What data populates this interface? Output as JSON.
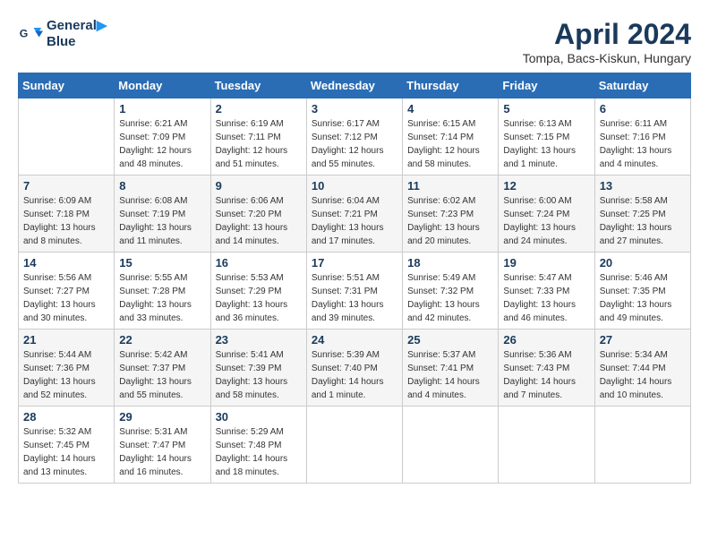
{
  "header": {
    "logo_line1": "General",
    "logo_line2": "Blue",
    "month_title": "April 2024",
    "location": "Tompa, Bacs-Kiskun, Hungary"
  },
  "weekdays": [
    "Sunday",
    "Monday",
    "Tuesday",
    "Wednesday",
    "Thursday",
    "Friday",
    "Saturday"
  ],
  "weeks": [
    [
      {
        "day": "",
        "info": ""
      },
      {
        "day": "1",
        "info": "Sunrise: 6:21 AM\nSunset: 7:09 PM\nDaylight: 12 hours\nand 48 minutes."
      },
      {
        "day": "2",
        "info": "Sunrise: 6:19 AM\nSunset: 7:11 PM\nDaylight: 12 hours\nand 51 minutes."
      },
      {
        "day": "3",
        "info": "Sunrise: 6:17 AM\nSunset: 7:12 PM\nDaylight: 12 hours\nand 55 minutes."
      },
      {
        "day": "4",
        "info": "Sunrise: 6:15 AM\nSunset: 7:14 PM\nDaylight: 12 hours\nand 58 minutes."
      },
      {
        "day": "5",
        "info": "Sunrise: 6:13 AM\nSunset: 7:15 PM\nDaylight: 13 hours\nand 1 minute."
      },
      {
        "day": "6",
        "info": "Sunrise: 6:11 AM\nSunset: 7:16 PM\nDaylight: 13 hours\nand 4 minutes."
      }
    ],
    [
      {
        "day": "7",
        "info": "Sunrise: 6:09 AM\nSunset: 7:18 PM\nDaylight: 13 hours\nand 8 minutes."
      },
      {
        "day": "8",
        "info": "Sunrise: 6:08 AM\nSunset: 7:19 PM\nDaylight: 13 hours\nand 11 minutes."
      },
      {
        "day": "9",
        "info": "Sunrise: 6:06 AM\nSunset: 7:20 PM\nDaylight: 13 hours\nand 14 minutes."
      },
      {
        "day": "10",
        "info": "Sunrise: 6:04 AM\nSunset: 7:21 PM\nDaylight: 13 hours\nand 17 minutes."
      },
      {
        "day": "11",
        "info": "Sunrise: 6:02 AM\nSunset: 7:23 PM\nDaylight: 13 hours\nand 20 minutes."
      },
      {
        "day": "12",
        "info": "Sunrise: 6:00 AM\nSunset: 7:24 PM\nDaylight: 13 hours\nand 24 minutes."
      },
      {
        "day": "13",
        "info": "Sunrise: 5:58 AM\nSunset: 7:25 PM\nDaylight: 13 hours\nand 27 minutes."
      }
    ],
    [
      {
        "day": "14",
        "info": "Sunrise: 5:56 AM\nSunset: 7:27 PM\nDaylight: 13 hours\nand 30 minutes."
      },
      {
        "day": "15",
        "info": "Sunrise: 5:55 AM\nSunset: 7:28 PM\nDaylight: 13 hours\nand 33 minutes."
      },
      {
        "day": "16",
        "info": "Sunrise: 5:53 AM\nSunset: 7:29 PM\nDaylight: 13 hours\nand 36 minutes."
      },
      {
        "day": "17",
        "info": "Sunrise: 5:51 AM\nSunset: 7:31 PM\nDaylight: 13 hours\nand 39 minutes."
      },
      {
        "day": "18",
        "info": "Sunrise: 5:49 AM\nSunset: 7:32 PM\nDaylight: 13 hours\nand 42 minutes."
      },
      {
        "day": "19",
        "info": "Sunrise: 5:47 AM\nSunset: 7:33 PM\nDaylight: 13 hours\nand 46 minutes."
      },
      {
        "day": "20",
        "info": "Sunrise: 5:46 AM\nSunset: 7:35 PM\nDaylight: 13 hours\nand 49 minutes."
      }
    ],
    [
      {
        "day": "21",
        "info": "Sunrise: 5:44 AM\nSunset: 7:36 PM\nDaylight: 13 hours\nand 52 minutes."
      },
      {
        "day": "22",
        "info": "Sunrise: 5:42 AM\nSunset: 7:37 PM\nDaylight: 13 hours\nand 55 minutes."
      },
      {
        "day": "23",
        "info": "Sunrise: 5:41 AM\nSunset: 7:39 PM\nDaylight: 13 hours\nand 58 minutes."
      },
      {
        "day": "24",
        "info": "Sunrise: 5:39 AM\nSunset: 7:40 PM\nDaylight: 14 hours\nand 1 minute."
      },
      {
        "day": "25",
        "info": "Sunrise: 5:37 AM\nSunset: 7:41 PM\nDaylight: 14 hours\nand 4 minutes."
      },
      {
        "day": "26",
        "info": "Sunrise: 5:36 AM\nSunset: 7:43 PM\nDaylight: 14 hours\nand 7 minutes."
      },
      {
        "day": "27",
        "info": "Sunrise: 5:34 AM\nSunset: 7:44 PM\nDaylight: 14 hours\nand 10 minutes."
      }
    ],
    [
      {
        "day": "28",
        "info": "Sunrise: 5:32 AM\nSunset: 7:45 PM\nDaylight: 14 hours\nand 13 minutes."
      },
      {
        "day": "29",
        "info": "Sunrise: 5:31 AM\nSunset: 7:47 PM\nDaylight: 14 hours\nand 16 minutes."
      },
      {
        "day": "30",
        "info": "Sunrise: 5:29 AM\nSunset: 7:48 PM\nDaylight: 14 hours\nand 18 minutes."
      },
      {
        "day": "",
        "info": ""
      },
      {
        "day": "",
        "info": ""
      },
      {
        "day": "",
        "info": ""
      },
      {
        "day": "",
        "info": ""
      }
    ]
  ]
}
